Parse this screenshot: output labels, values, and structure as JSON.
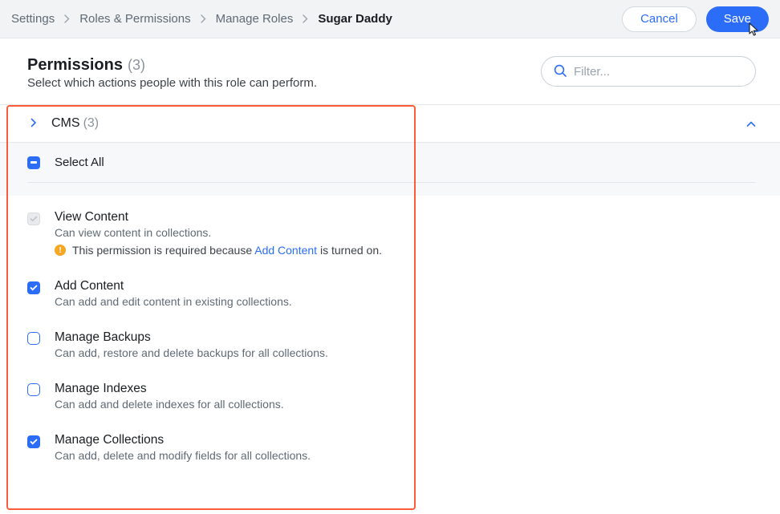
{
  "breadcrumb": {
    "items": [
      "Settings",
      "Roles & Permissions",
      "Manage Roles",
      "Sugar Daddy"
    ]
  },
  "actions": {
    "cancel": "Cancel",
    "save": "Save"
  },
  "header": {
    "title": "Permissions",
    "count": "(3)",
    "subtitle": "Select which actions people with this role can perform."
  },
  "filter": {
    "placeholder": "Filter..."
  },
  "section": {
    "title": "CMS",
    "count": "(3)"
  },
  "select_all": {
    "label": "Select All"
  },
  "permissions": [
    {
      "title": "View Content",
      "desc": "Can view content in collections.",
      "note_prefix": "This permission is required because ",
      "note_link": "Add Content",
      "note_suffix": " is turned on.",
      "state": "locked"
    },
    {
      "title": "Add Content",
      "desc": "Can add and edit content in existing collections.",
      "state": "checked"
    },
    {
      "title": "Manage Backups",
      "desc": "Can add, restore and delete backups for all collections.",
      "state": "unchecked"
    },
    {
      "title": "Manage Indexes",
      "desc": "Can add and delete indexes for all collections.",
      "state": "unchecked"
    },
    {
      "title": "Manage Collections",
      "desc": "Can add, delete and modify fields for all collections.",
      "state": "checked"
    }
  ]
}
